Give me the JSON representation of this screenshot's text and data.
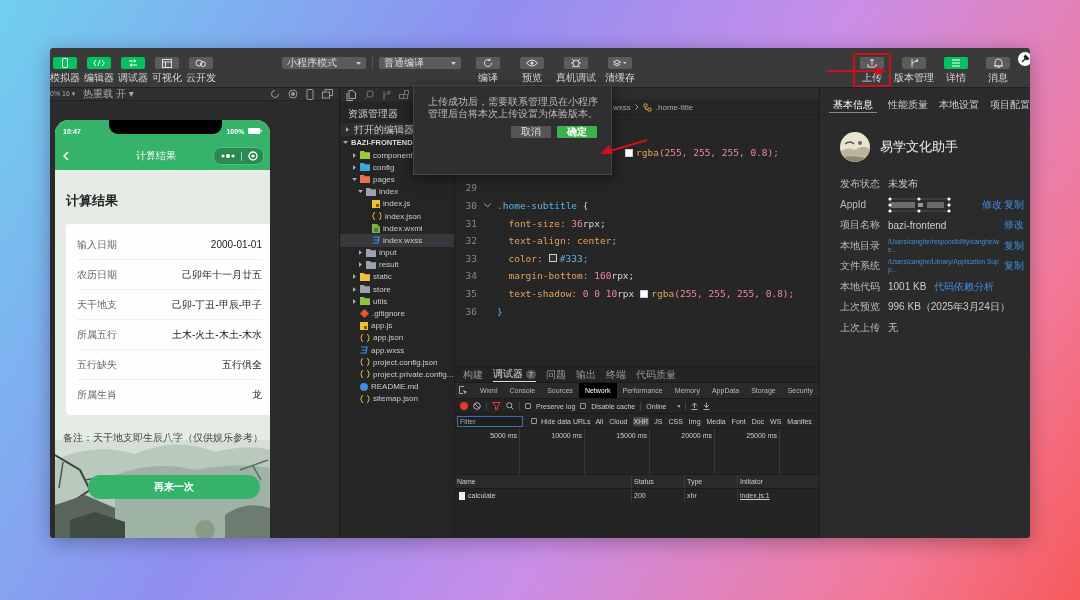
{
  "toolbar": {
    "view_toggles": [
      {
        "label": "模拟器",
        "on": true
      },
      {
        "label": "编辑器",
        "on": true
      },
      {
        "label": "调试器",
        "on": true
      },
      {
        "label": "可视化",
        "on": false
      },
      {
        "label": "云开发",
        "on": false
      }
    ],
    "mode_select": {
      "value": "小程序模式"
    },
    "compile_select": {
      "value": "普通编译"
    },
    "actions": [
      {
        "label": "编译"
      },
      {
        "label": "预览"
      },
      {
        "label": "真机调试"
      },
      {
        "label": "清缓存"
      }
    ],
    "right_actions": [
      {
        "label": "上传",
        "on": false,
        "highlighted": true
      },
      {
        "label": "版本管理",
        "on": false,
        "highlighted": false
      },
      {
        "label": "详情",
        "on": true,
        "highlighted": false
      },
      {
        "label": "消息",
        "on": false,
        "highlighted": false
      }
    ]
  },
  "simulator": {
    "zoom": "0% 16 ▾",
    "hot_reload": "热重载 开 ▾",
    "phone": {
      "time": "10:47",
      "battery": "100%",
      "nav_title": "计算结果",
      "heading": "计算结果",
      "rows": [
        {
          "label": "输入日期",
          "value": "2000-01-01"
        },
        {
          "label": "农历日期",
          "value": "己卯年十一月廿五"
        },
        {
          "label": "天干地支",
          "value": "己卯-丁丑-甲辰-甲子"
        },
        {
          "label": "所属五行",
          "value": "土木-火土-木土-木水"
        },
        {
          "label": "五行缺失",
          "value": "五行俱全"
        },
        {
          "label": "所属生肖",
          "value": "龙"
        }
      ],
      "note": "备注：天干地支即生辰八字（仅供娱乐参考）",
      "button": "再来一次"
    }
  },
  "explorer": {
    "title": "资源管理器",
    "open_editors": {
      "label": "打开的编辑器",
      "expanded": false
    },
    "project": {
      "label": "BAZI-FRONTEND",
      "expanded": true,
      "children": [
        {
          "name": "component",
          "kind": "folder",
          "color": "#9ccc3c",
          "expanded": false,
          "selected": false
        },
        {
          "name": "config",
          "kind": "folder",
          "color": "#3fa7e0",
          "expanded": false,
          "selected": false
        },
        {
          "name": "pages",
          "kind": "folder",
          "color": "#e8734a",
          "expanded": true,
          "selected": false,
          "children": [
            {
              "name": "index",
              "kind": "folder",
              "color": "#9aa3ad",
              "expanded": true,
              "selected": false,
              "children": [
                {
                  "name": "index.js",
                  "kind": "js",
                  "selected": false
                },
                {
                  "name": "index.json",
                  "kind": "json",
                  "selected": false
                },
                {
                  "name": "index.wxml",
                  "kind": "wxml",
                  "selected": false
                },
                {
                  "name": "index.wxss",
                  "kind": "wxss",
                  "selected": true
                }
              ]
            },
            {
              "name": "input",
              "kind": "folder",
              "color": "#9aa3ad",
              "expanded": false,
              "selected": false
            },
            {
              "name": "result",
              "kind": "folder",
              "color": "#9aa3ad",
              "expanded": false,
              "selected": false
            }
          ]
        },
        {
          "name": "static",
          "kind": "folder",
          "color": "#f0c040",
          "expanded": false,
          "selected": false
        },
        {
          "name": "store",
          "kind": "folder",
          "color": "#9aa3ad",
          "expanded": false,
          "selected": false
        },
        {
          "name": "utils",
          "kind": "folder",
          "color": "#8bc34a",
          "expanded": false,
          "selected": false
        },
        {
          "name": ".gitignore",
          "kind": "git",
          "selected": false
        },
        {
          "name": "app.js",
          "kind": "js",
          "selected": false
        },
        {
          "name": "app.json",
          "kind": "json",
          "selected": false
        },
        {
          "name": "app.wxss",
          "kind": "wxss",
          "selected": false
        },
        {
          "name": "project.config.json",
          "kind": "json",
          "selected": false
        },
        {
          "name": "project.private.config...",
          "kind": "json",
          "selected": false
        },
        {
          "name": "README.md",
          "kind": "md",
          "selected": false
        },
        {
          "name": "sitemap.json",
          "kind": "json",
          "selected": false
        }
      ]
    }
  },
  "editor": {
    "breadcrumb": [
      "wxss",
      ".home-title"
    ],
    "lines": [
      {
        "kind": "partial",
        "tokens": [
          {
            "kind": "swatch",
            "color": "#ffffff"
          },
          {
            "kind": "fn",
            "text": "rgba"
          },
          {
            "kind": "num",
            "text": "(255, 255, 255, 0.8);"
          }
        ]
      },
      {
        "number": "29"
      },
      {
        "number": "30",
        "expanded": true,
        "tokens": [
          {
            "kind": "sel",
            "text": ".home-subtitle"
          },
          {
            "kind": "plain",
            "text": " {"
          }
        ]
      },
      {
        "number": "31",
        "tokens": [
          {
            "kind": "prop",
            "text": "  font-size:"
          },
          {
            "kind": "num",
            "text": " 36"
          },
          {
            "kind": "plain",
            "text": "rpx;"
          }
        ]
      },
      {
        "number": "32",
        "tokens": [
          {
            "kind": "prop",
            "text": "  text-align: center;"
          }
        ]
      },
      {
        "number": "33",
        "tokens": [
          {
            "kind": "prop",
            "text": "  color:"
          },
          {
            "kind": "swatch",
            "color": "#333333"
          },
          {
            "kind": "sel",
            "text": "#333;"
          }
        ]
      },
      {
        "number": "34",
        "tokens": [
          {
            "kind": "prop",
            "text": "  margin-bottom:"
          },
          {
            "kind": "num",
            "text": " 160"
          },
          {
            "kind": "plain",
            "text": "rpx;"
          }
        ]
      },
      {
        "number": "35",
        "tokens": [
          {
            "kind": "prop",
            "text": "  text-shadow:"
          },
          {
            "kind": "num",
            "text": " 0 0 10"
          },
          {
            "kind": "plain",
            "text": "rpx"
          },
          {
            "kind": "swatch",
            "color": "#ffffff"
          },
          {
            "kind": "fn",
            "text": "rgba"
          },
          {
            "kind": "num",
            "text": "(255, 255, 255, 0.8);"
          }
        ]
      },
      {
        "number": "36",
        "tokens": [
          {
            "kind": "sel",
            "text": "}"
          }
        ]
      }
    ]
  },
  "dialog": {
    "message": "上传成功后，需要联系管理员在小程序管理后台将本次上传设置为体验版本。",
    "buttons": [
      {
        "label": "取消",
        "kind": "secondary"
      },
      {
        "label": "确定",
        "kind": "primary"
      }
    ]
  },
  "bottom_panel": {
    "tabs": [
      {
        "label": "构建",
        "selected": false
      },
      {
        "label": "调试器",
        "selected": true,
        "badge": "7"
      },
      {
        "label": "问题",
        "selected": false
      },
      {
        "label": "输出",
        "selected": false
      },
      {
        "label": "终端",
        "selected": false
      },
      {
        "label": "代码质量",
        "selected": false
      }
    ],
    "devtools_tabs": [
      {
        "label": "Wxml",
        "selected": false
      },
      {
        "label": "Console",
        "selected": false
      },
      {
        "label": "Sources",
        "selected": false
      },
      {
        "label": "Network",
        "selected": true
      },
      {
        "label": "Performance",
        "selected": false
      },
      {
        "label": "Memory",
        "selected": false
      },
      {
        "label": "AppData",
        "selected": false
      },
      {
        "label": "Storage",
        "selected": false
      },
      {
        "label": "Security",
        "selected": false
      }
    ],
    "preserve_log": {
      "label": "Preserve log",
      "checked": false
    },
    "disable_cache": {
      "label": "Disable cache",
      "checked": false
    },
    "throttle": "Online",
    "filter": {
      "placeholder": "Filter"
    },
    "hide_data_urls": {
      "label": "Hide data URLs",
      "checked": false
    },
    "types": [
      {
        "label": "All",
        "selected": false
      },
      {
        "label": "Cloud",
        "selected": false
      },
      {
        "label": "XHR",
        "selected": true
      },
      {
        "label": "JS",
        "selected": false
      },
      {
        "label": "CSS",
        "selected": false
      },
      {
        "label": "Img",
        "selected": false
      },
      {
        "label": "Media",
        "selected": false
      },
      {
        "label": "Font",
        "selected": false
      },
      {
        "label": "Doc",
        "selected": false
      },
      {
        "label": "WS",
        "selected": false
      },
      {
        "label": "Manifes",
        "selected": false
      }
    ],
    "timeline": [
      "5000 ms",
      "10000 ms",
      "15000 ms",
      "20000 ms",
      "25000 ms"
    ],
    "columns": [
      "Name",
      "Status",
      "Type",
      "Initiator"
    ],
    "rows": [
      {
        "name": "calculate",
        "status": "200",
        "type": "xhr",
        "initiator": "index.js:1"
      }
    ]
  },
  "details": {
    "tabs": [
      {
        "label": "基本信息",
        "selected": true
      },
      {
        "label": "性能质量",
        "selected": false
      },
      {
        "label": "本地设置",
        "selected": false
      },
      {
        "label": "项目配置",
        "selected": false
      }
    ],
    "app_name": "易学文化助手",
    "rows": [
      {
        "label": "发布状态",
        "kind": "text",
        "value": "未发布"
      },
      {
        "label": "AppId",
        "kind": "redacted",
        "actions": [
          "修改",
          "复制"
        ]
      },
      {
        "label": "项目名称",
        "kind": "text",
        "value": "bazi-frontend",
        "actions": [
          "修改"
        ]
      },
      {
        "label": "本地目录",
        "kind": "path",
        "value": "/Users/canghe/responsibility/canghe/we...",
        "actions": [
          "复制"
        ]
      },
      {
        "label": "文件系统",
        "kind": "path",
        "value": "/Users/canghe/Library/Application Supp...",
        "actions": [
          "复制"
        ]
      },
      {
        "label": "本地代码",
        "kind": "text",
        "value": "1001 KB",
        "link": "代码依赖分析"
      },
      {
        "label": "上次预览",
        "kind": "text",
        "value": "996 KB（2025年3月24日）"
      },
      {
        "label": "上次上传",
        "kind": "text",
        "value": "无"
      }
    ]
  }
}
